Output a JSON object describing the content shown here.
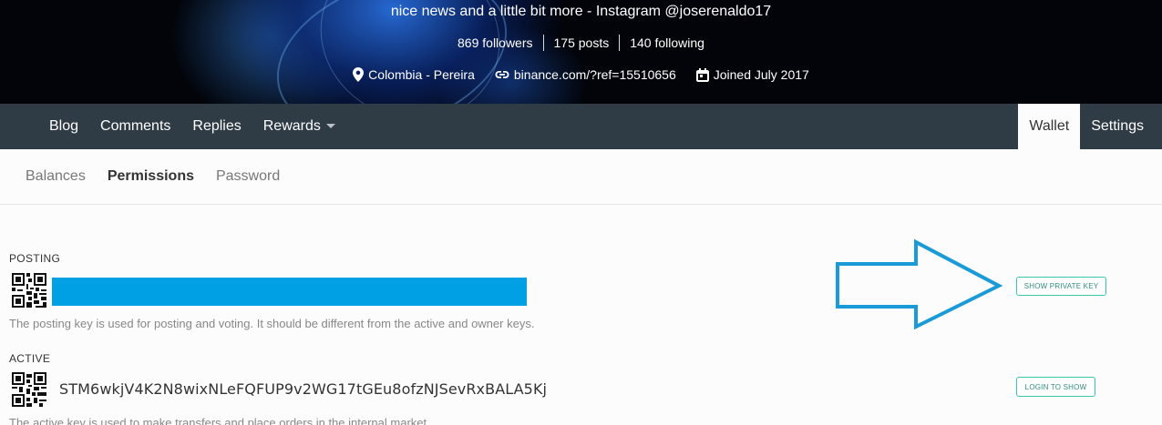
{
  "header": {
    "tagline": "nice news and a little bit more - Instagram @joserenaldo17",
    "stats": {
      "followers": "869 followers",
      "posts": "175 posts",
      "following": "140 following"
    },
    "location": "Colombia - Pereira",
    "website": "binance.com/?ref=15510656",
    "joined": "Joined July 2017"
  },
  "nav": {
    "left": [
      "Blog",
      "Comments",
      "Replies",
      "Rewards"
    ],
    "right": [
      "Wallet",
      "Settings"
    ],
    "active": "Wallet"
  },
  "subtabs": {
    "balances": "Balances",
    "permissions": "Permissions",
    "password": "Password",
    "active": "Permissions"
  },
  "permissions": {
    "posting": {
      "label": "POSTING",
      "description": "The posting key is used for posting and voting. It should be different from the active and owner keys.",
      "button": "SHOW PRIVATE KEY"
    },
    "active": {
      "label": "ACTIVE",
      "key": "STM6wkjV4K2N8wixNLeFQFUP9v2WG17tGEu8ofzNJSevRxBALA5Kj",
      "description": "The active key is used to make transfers and place orders in the internal market.",
      "button": "LOGIN TO SHOW"
    }
  },
  "colors": {
    "navbar": "#2f3b45",
    "redaction": "#00a1e4",
    "button_border": "#3ac7b0",
    "annotation_arrow": "#1a9bd7"
  },
  "icons": [
    "location-pin-icon",
    "link-icon",
    "calendar-icon",
    "caret-down-icon",
    "qr-code-icon",
    "arrow-annotation-icon"
  ]
}
